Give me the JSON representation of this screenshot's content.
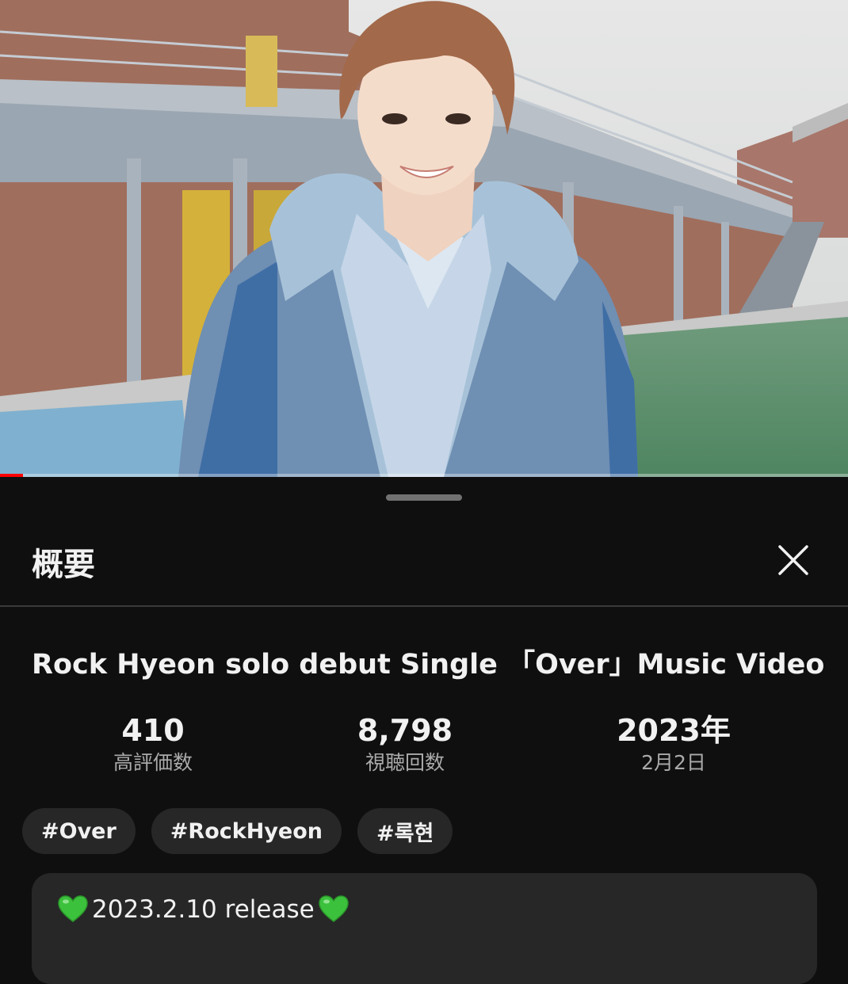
{
  "player": {
    "progress_fraction": 0.027
  },
  "panel": {
    "title": "概要",
    "close_icon": "close-icon"
  },
  "video": {
    "title": "Rock Hyeon solo debut Single 「Over」Music Video"
  },
  "stats": {
    "likes": {
      "value": "410",
      "label": "高評価数"
    },
    "views": {
      "value": "8,798",
      "label": "視聴回数"
    },
    "date": {
      "value": "2023年",
      "label": "2月2日"
    }
  },
  "hashtags": [
    "#Over",
    "#RockHyeon",
    "#록현"
  ],
  "description": {
    "heart_icon": "green-heart-icon",
    "text": "2023.2.10 release"
  },
  "colors": {
    "background": "#0f0f0f",
    "chip_bg": "#272727",
    "secondary_text": "#aaaaaa",
    "heart": "#3cc13c",
    "progress": "#ff0000"
  }
}
